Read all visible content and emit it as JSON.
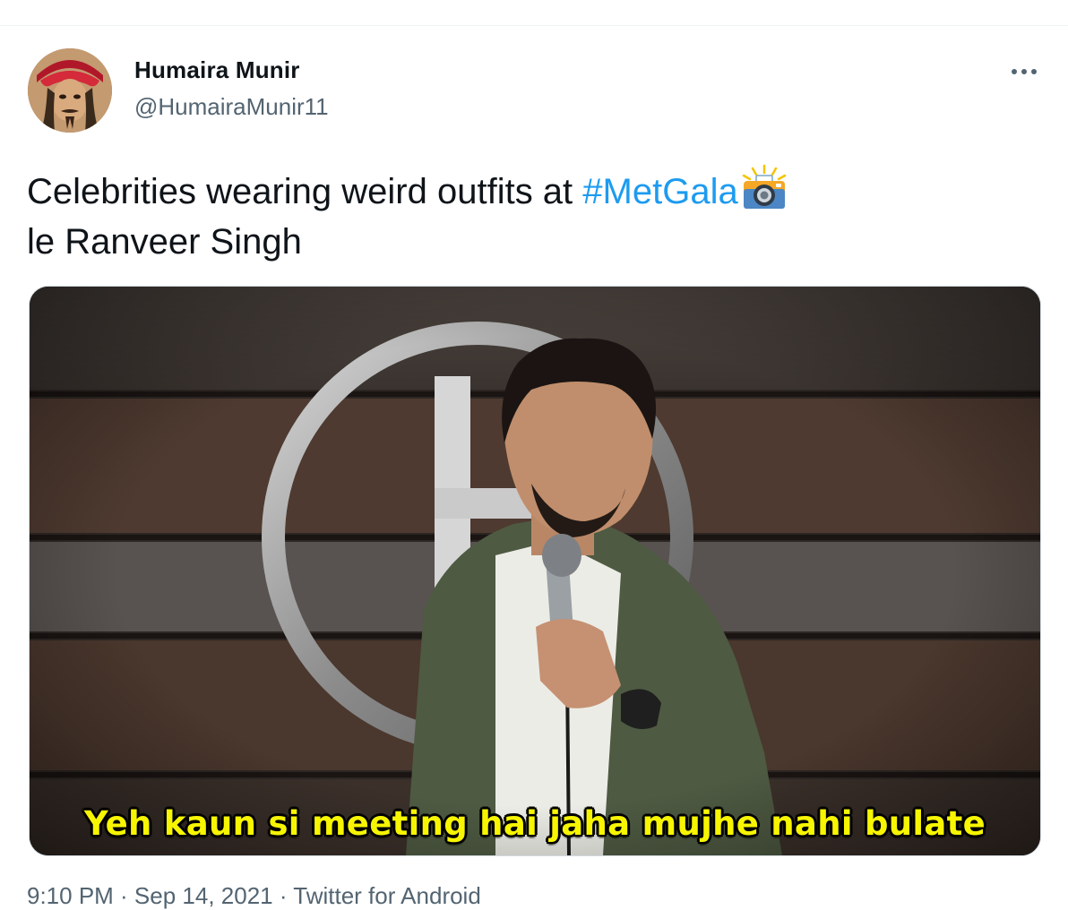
{
  "tweet": {
    "author": {
      "display_name": "Humaira Munir",
      "handle": "@HumairaMunir11"
    },
    "text_parts": {
      "line1_prefix": "Celebrities wearing weird outfits at ",
      "hashtag": "#MetGala",
      "line2": "le Ranveer Singh"
    },
    "emoji": "camera-with-flash-emoji",
    "media": {
      "caption": "Yeh kaun si meeting hai jaha mujhe nahi bulate"
    },
    "meta_partial": "9:10 PM · Sep 14, 2021 · Twitter for Android"
  },
  "colors": {
    "link": "#1d9bf0",
    "secondary_text": "#536471",
    "caption": "#f7f500"
  }
}
